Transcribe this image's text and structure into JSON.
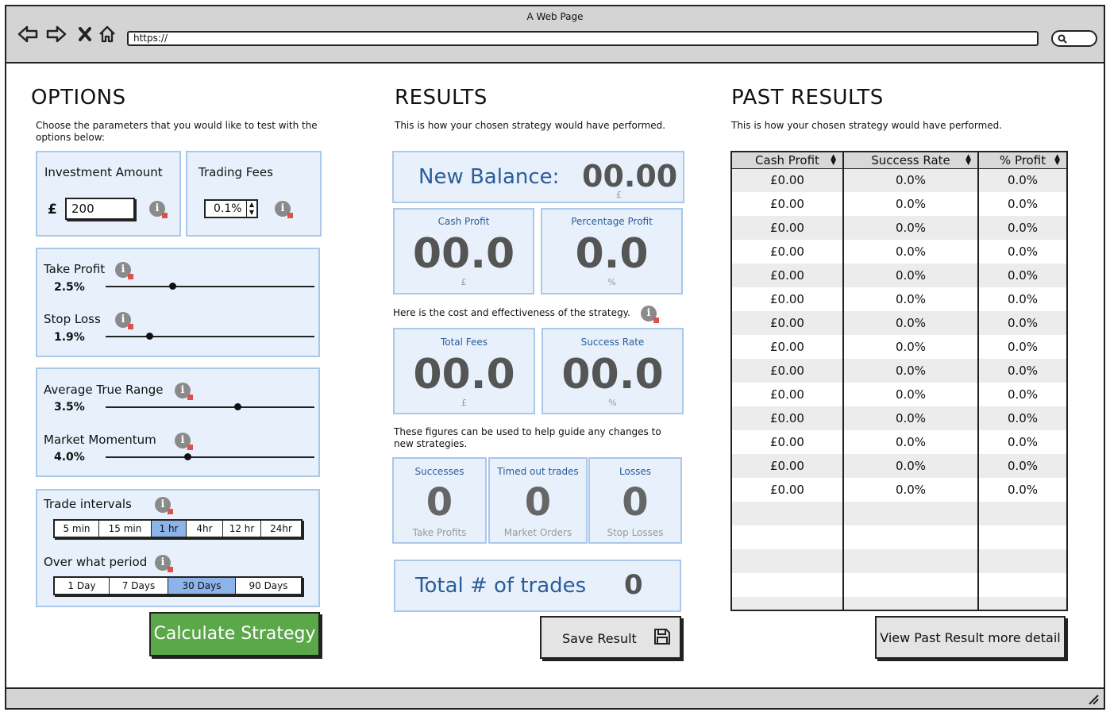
{
  "browser": {
    "title": "A Web Page",
    "url": "https://"
  },
  "options": {
    "heading": "OPTIONS",
    "description": "Choose the parameters that you would like to test with the options below:",
    "investment": {
      "label": "Investment Amount",
      "currency": "£",
      "value": "200"
    },
    "fees": {
      "label": "Trading Fees",
      "value": "0.1%"
    },
    "take_profit": {
      "label": "Take Profit",
      "value": "2.5%",
      "fraction": 0.32
    },
    "stop_loss": {
      "label": "Stop Loss",
      "value": "1.9%",
      "fraction": 0.21
    },
    "atr": {
      "label": "Average True Range",
      "value": "3.5%",
      "fraction": 0.63
    },
    "momentum": {
      "label": "Market Momentum",
      "value": "4.0%",
      "fraction": 0.39
    },
    "intervals": {
      "label": "Trade intervals",
      "options": [
        "5 min",
        "15 min",
        "1 hr",
        "4hr",
        "12 hr",
        "24hr"
      ],
      "selected": "1 hr"
    },
    "period": {
      "label": "Over what period",
      "options": [
        "1 Day",
        "7 Days",
        "30 Days",
        "90 Days"
      ],
      "selected": "30 Days"
    },
    "calculate_label": "Calculate Strategy"
  },
  "results": {
    "heading": "RESULTS",
    "description": "This is how your chosen strategy would have performed.",
    "new_balance": {
      "label": "New Balance:",
      "value": "00.00",
      "unit": "£"
    },
    "cash_profit": {
      "label": "Cash Profit",
      "value": "00.0",
      "unit": "£"
    },
    "percentage_profit": {
      "label": "Percentage Profit",
      "value": "0.0",
      "unit": "%"
    },
    "cost_text": "Here is the cost and effectiveness of the strategy.",
    "total_fees": {
      "label": "Total Fees",
      "value": "00.0",
      "unit": "£"
    },
    "success_rate": {
      "label": "Success Rate",
      "value": "00.0",
      "unit": "%"
    },
    "guide_text": "These figures can be used to help guide any changes to new strategies.",
    "successes": {
      "label": "Successes",
      "value": "0",
      "sub": "Take Profits"
    },
    "timed_out": {
      "label": "Timed out trades",
      "value": "0",
      "sub": "Market Orders"
    },
    "losses": {
      "label": "Losses",
      "value": "0",
      "sub": "Stop Losses"
    },
    "total_trades": {
      "label": "Total # of trades",
      "value": "0"
    },
    "save_label": "Save Result"
  },
  "past": {
    "heading": "PAST RESULTS",
    "description": "This is how your chosen strategy would have performed.",
    "columns": [
      "Cash Profit",
      "Success Rate",
      "% Profit"
    ],
    "rows": [
      [
        "£0.00",
        "0.0%",
        "0.0%"
      ],
      [
        "£0.00",
        "0.0%",
        "0.0%"
      ],
      [
        "£0.00",
        "0.0%",
        "0.0%"
      ],
      [
        "£0.00",
        "0.0%",
        "0.0%"
      ],
      [
        "£0.00",
        "0.0%",
        "0.0%"
      ],
      [
        "£0.00",
        "0.0%",
        "0.0%"
      ],
      [
        "£0.00",
        "0.0%",
        "0.0%"
      ],
      [
        "£0.00",
        "0.0%",
        "0.0%"
      ],
      [
        "£0.00",
        "0.0%",
        "0.0%"
      ],
      [
        "£0.00",
        "0.0%",
        "0.0%"
      ],
      [
        "£0.00",
        "0.0%",
        "0.0%"
      ],
      [
        "£0.00",
        "0.0%",
        "0.0%"
      ],
      [
        "£0.00",
        "0.0%",
        "0.0%"
      ],
      [
        "£0.00",
        "0.0%",
        "0.0%"
      ],
      [
        "",
        "",
        ""
      ],
      [
        "",
        "",
        ""
      ],
      [
        "",
        "",
        ""
      ],
      [
        "",
        "",
        ""
      ],
      [
        "",
        "",
        ""
      ]
    ],
    "detail_label": "View Past Result more detail"
  },
  "colors": {
    "panel": "#e8f1fb",
    "panel_border": "#a9c8ea",
    "accent": "#2a5d9a",
    "calculate": "#5aa84a",
    "selected": "#8cb4ea"
  }
}
